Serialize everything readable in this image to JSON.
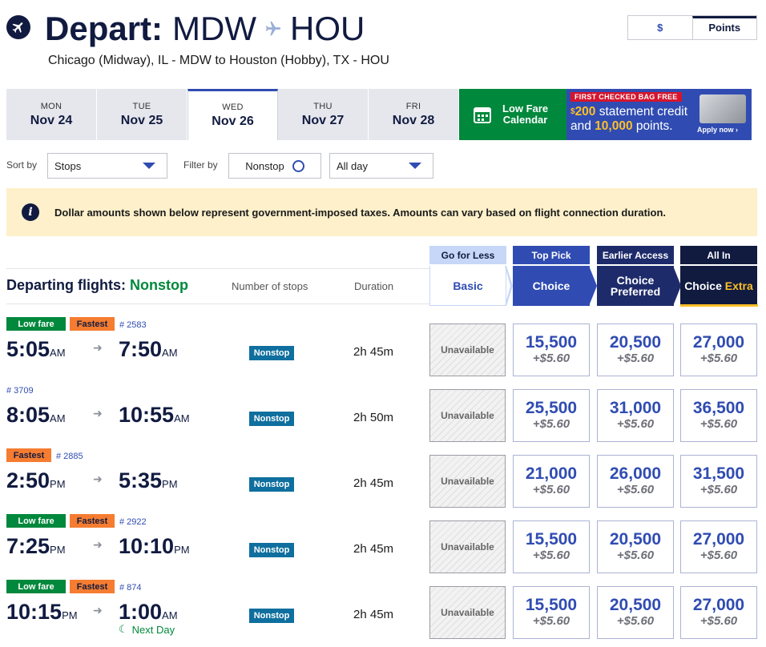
{
  "header": {
    "depart_label": "Depart:",
    "origin": "MDW",
    "destination": "HOU",
    "subtitle": "Chicago (Midway), IL - MDW to Houston (Hobby), TX - HOU",
    "currency_toggle": [
      "$",
      "Points"
    ]
  },
  "days": [
    {
      "dow": "MON",
      "date": "Nov 24"
    },
    {
      "dow": "TUE",
      "date": "Nov 25"
    },
    {
      "dow": "WED",
      "date": "Nov 26"
    },
    {
      "dow": "THU",
      "date": "Nov 27"
    },
    {
      "dow": "FRI",
      "date": "Nov 28"
    }
  ],
  "low_fare": {
    "line1": "Low Fare",
    "line2": "Calendar"
  },
  "promo": {
    "tag": "FIRST CHECKED BAG FREE",
    "line1_dollar": "$",
    "line1_amount": "200",
    "line1_rest": " statement credit",
    "line2_pre": "and ",
    "line2_points": "10,000",
    "line2_rest": " points.",
    "apply": "Apply now"
  },
  "filters": {
    "sort_label": "Sort by",
    "sort_value": "Stops",
    "filter_label": "Filter by",
    "nonstop_label": "Nonstop",
    "time_value": "All day"
  },
  "notice": "Dollar amounts shown below represent government-imposed taxes. Amounts can vary based on flight connection duration.",
  "columns": {
    "departing": "Departing flights: ",
    "nonstop": "Nonstop",
    "stops": "Number of stops",
    "duration": "Duration"
  },
  "fares": [
    {
      "tab": "Go for Less",
      "name": "Basic"
    },
    {
      "tab": "Top Pick",
      "name": "Choice"
    },
    {
      "tab": "Earlier Access",
      "name": "Choice Preferred"
    },
    {
      "tab": "All In",
      "name": "Choice",
      "extra": "Extra"
    }
  ],
  "unavailable_label": "Unavailable",
  "next_day_label": "Next Day",
  "colors": {
    "navy": "#111b40",
    "blue": "#304cb2",
    "green": "#00883c",
    "orange": "#f57c30",
    "notice": "#fdf0ca"
  },
  "flights": [
    {
      "low_fare": "Low fare",
      "fastest": "Fastest",
      "flight": "# 2583",
      "dep": "5:05",
      "dep_ap": "AM",
      "arr": "7:50",
      "arr_ap": "AM",
      "stops": "Nonstop",
      "duration": "2h 45m",
      "prices": [
        "15,500",
        "20,500",
        "27,000"
      ],
      "tax": "+$5.60"
    },
    {
      "flight": "# 3709",
      "dep": "8:05",
      "dep_ap": "AM",
      "arr": "10:55",
      "arr_ap": "AM",
      "stops": "Nonstop",
      "duration": "2h 50m",
      "prices": [
        "25,500",
        "31,000",
        "36,500"
      ],
      "tax": "+$5.60"
    },
    {
      "fastest": "Fastest",
      "flight": "# 2885",
      "dep": "2:50",
      "dep_ap": "PM",
      "arr": "5:35",
      "arr_ap": "PM",
      "stops": "Nonstop",
      "duration": "2h 45m",
      "prices": [
        "21,000",
        "26,000",
        "31,500"
      ],
      "tax": "+$5.60"
    },
    {
      "low_fare": "Low fare",
      "fastest": "Fastest",
      "flight": "# 2922",
      "dep": "7:25",
      "dep_ap": "PM",
      "arr": "10:10",
      "arr_ap": "PM",
      "stops": "Nonstop",
      "duration": "2h 45m",
      "prices": [
        "15,500",
        "20,500",
        "27,000"
      ],
      "tax": "+$5.60"
    },
    {
      "low_fare": "Low fare",
      "fastest": "Fastest",
      "flight": "# 874",
      "dep": "10:15",
      "dep_ap": "PM",
      "arr": "1:00",
      "arr_ap": "AM",
      "stops": "Nonstop",
      "duration": "2h 45m",
      "prices": [
        "15,500",
        "20,500",
        "27,000"
      ],
      "tax": "+$5.60"
    }
  ]
}
